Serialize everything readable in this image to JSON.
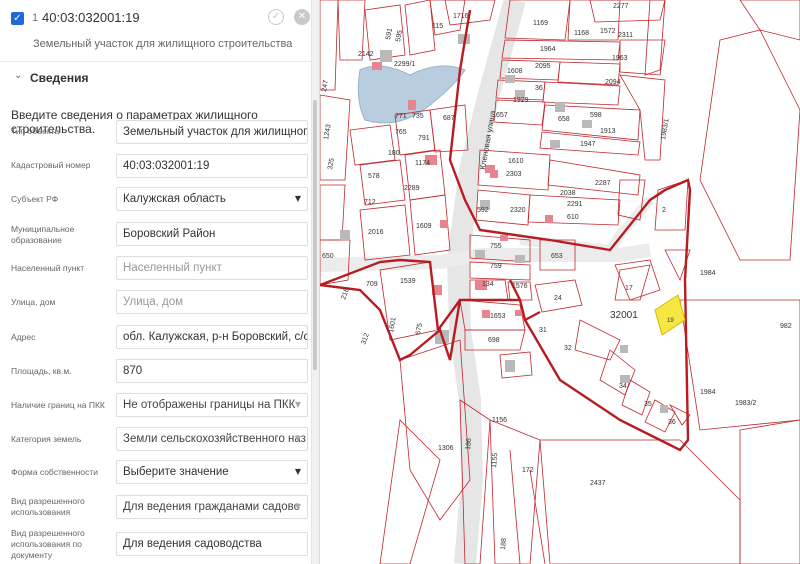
{
  "panel": {
    "item_index": "1",
    "cadastral_title": "40:03:032001:19",
    "subtitle": "Земельный участок для жилищного строительства",
    "section_title": "Сведения",
    "intro": "Введите сведения о параметрах жилищного строительства.",
    "fields": [
      {
        "label": "Тип объекта",
        "value": "Земельный участок для жилищного с"
      },
      {
        "label": "Кадастровый номер",
        "value": "40:03:032001:19"
      },
      {
        "label": "Субъект РФ",
        "value": "Калужская область"
      },
      {
        "label": "Муниципальное образование",
        "value": "Боровский Район"
      },
      {
        "label": "Населенный пункт",
        "value": "",
        "placeholder": "Населенный пункт"
      },
      {
        "label": "Улица, дом",
        "value": "",
        "placeholder": "Улица, дом"
      },
      {
        "label": "Адрес",
        "value": "обл. Калужская, р-н Боровский, с/с Б"
      },
      {
        "label": "Площадь, кв.м.",
        "value": "870"
      },
      {
        "label": "Наличие границ на ПКК",
        "value": "Не отображены границы на ПКК"
      },
      {
        "label": "Категория земель",
        "value": "Земли сельскохозяйственного наз"
      },
      {
        "label": "Форма собственности",
        "value": "Выберите значение"
      },
      {
        "label": "Вид разрешенного использования",
        "value": "Для ведения гражданами садово"
      },
      {
        "label": "Вид разрешенного использования по документу",
        "value": "Для ведения садоводства"
      }
    ]
  },
  "map": {
    "street_label": "Кленовая улица",
    "quarter_label": "32001",
    "selected_parcel": "19",
    "selected_color": "#f5e642",
    "boundary_color": "#c0272d",
    "parcels": [
      "1716",
      "1169",
      "2277",
      "2142",
      "1168",
      "1572",
      "2311",
      "1964",
      "1963",
      "1608",
      "2095",
      "2094",
      "36",
      "2299/1",
      "687",
      "1929",
      "1243",
      "771",
      "765",
      "791",
      "657",
      "658",
      "598",
      "1913",
      "1947",
      "180",
      "1610",
      "2303",
      "1174",
      "2287",
      "578",
      "2289",
      "2038",
      "712",
      "2320",
      "592",
      "2291",
      "2016",
      "1609",
      "610",
      "2",
      "755",
      "759",
      "653",
      "1984",
      "650",
      "709",
      "1539",
      "134",
      "1576",
      "24",
      "17",
      "218",
      "1601",
      "675",
      "312",
      "1653",
      "698",
      "31",
      "32",
      "34",
      "35",
      "36",
      "1306",
      "1156",
      "186",
      "1155",
      "172",
      "2437",
      "1983/1",
      "1983/2",
      "982",
      "188",
      "247",
      "325",
      "591",
      "595",
      "735",
      "115",
      "19"
    ]
  }
}
